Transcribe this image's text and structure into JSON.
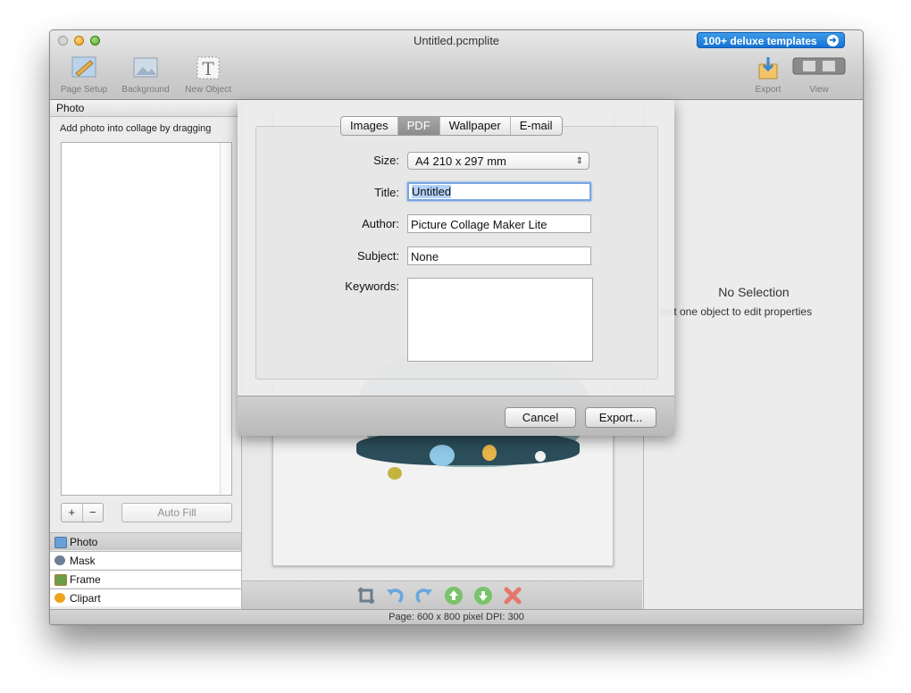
{
  "window": {
    "title": "Untitled.pcmplite",
    "promo_label": "100+ deluxe templates"
  },
  "toolbar": {
    "page_setup": "Page Setup",
    "background": "Background",
    "new_object": "New Object",
    "export": "Export",
    "view": "View"
  },
  "left_panel": {
    "header": "Photo",
    "hint": "Add photo into collage by dragging",
    "add_label": "+",
    "remove_label": "−",
    "auto_fill": "Auto Fill",
    "tabs": [
      {
        "label": "Photo"
      },
      {
        "label": "Mask"
      },
      {
        "label": "Frame"
      },
      {
        "label": "Clipart"
      }
    ]
  },
  "right_panel": {
    "title": "No Selection",
    "subtitle": "lect one object to edit properties"
  },
  "status": {
    "text": "Page: 600 x 800 pixel DPI: 300"
  },
  "export_sheet": {
    "tabs": [
      "Images",
      "PDF",
      "Wallpaper",
      "E-mail"
    ],
    "selected_tab": "PDF",
    "size_label": "Size:",
    "size_value": "A4 210 x 297 mm",
    "title_label": "Title:",
    "title_value": "Untitled",
    "author_label": "Author:",
    "author_value": "Picture Collage Maker Lite",
    "subject_label": "Subject:",
    "subject_value": "None",
    "keywords_label": "Keywords:",
    "keywords_value": "",
    "cancel_label": "Cancel",
    "export_label": "Export..."
  },
  "colors": {
    "promo": "#1672d3",
    "tab_selected": "#8c8c8c",
    "focus_ring": "#76a7e3"
  }
}
